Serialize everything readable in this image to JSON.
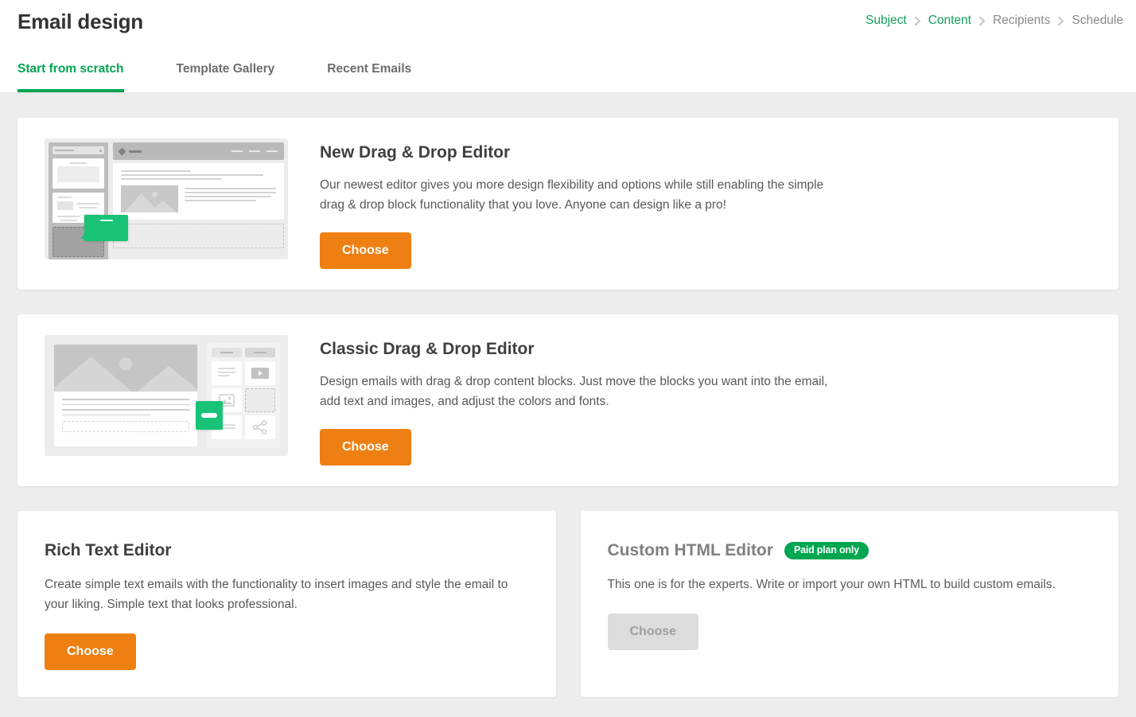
{
  "header": {
    "title": "Email design",
    "breadcrumb": [
      {
        "label": "Subject",
        "state": "done"
      },
      {
        "label": "Content",
        "state": "done"
      },
      {
        "label": "Recipients",
        "state": "pending"
      },
      {
        "label": "Schedule",
        "state": "pending"
      }
    ],
    "tabs": [
      {
        "label": "Start from scratch",
        "active": true
      },
      {
        "label": "Template Gallery",
        "active": false
      },
      {
        "label": "Recent Emails",
        "active": false
      }
    ]
  },
  "colors": {
    "brand_green": "#00a650",
    "accent_orange": "#ee8013",
    "page_background": "#ededed",
    "card_background": "#ffffff",
    "disabled_grey": "#dddddd"
  },
  "cards": {
    "new_drag_drop": {
      "title": "New Drag & Drop Editor",
      "description": "Our newest editor gives you more design flexibility and options while still enabling the simple drag & drop block functionality that you love. Anyone can design like a pro!",
      "button_label": "Choose"
    },
    "classic_drag_drop": {
      "title": "Classic Drag & Drop Editor",
      "description": "Design emails with drag & drop content blocks. Just move the blocks you want into the email, add text and images, and adjust the colors and fonts.",
      "button_label": "Choose"
    },
    "rich_text": {
      "title": "Rich Text Editor",
      "description": "Create simple text emails with the functionality to insert images and style the email to your liking. Simple text that looks professional.",
      "button_label": "Choose"
    },
    "custom_html": {
      "title": "Custom HTML Editor",
      "badge": "Paid plan only",
      "description": "This one is for the experts. Write or import your own HTML to build custom emails.",
      "button_label": "Choose"
    }
  }
}
